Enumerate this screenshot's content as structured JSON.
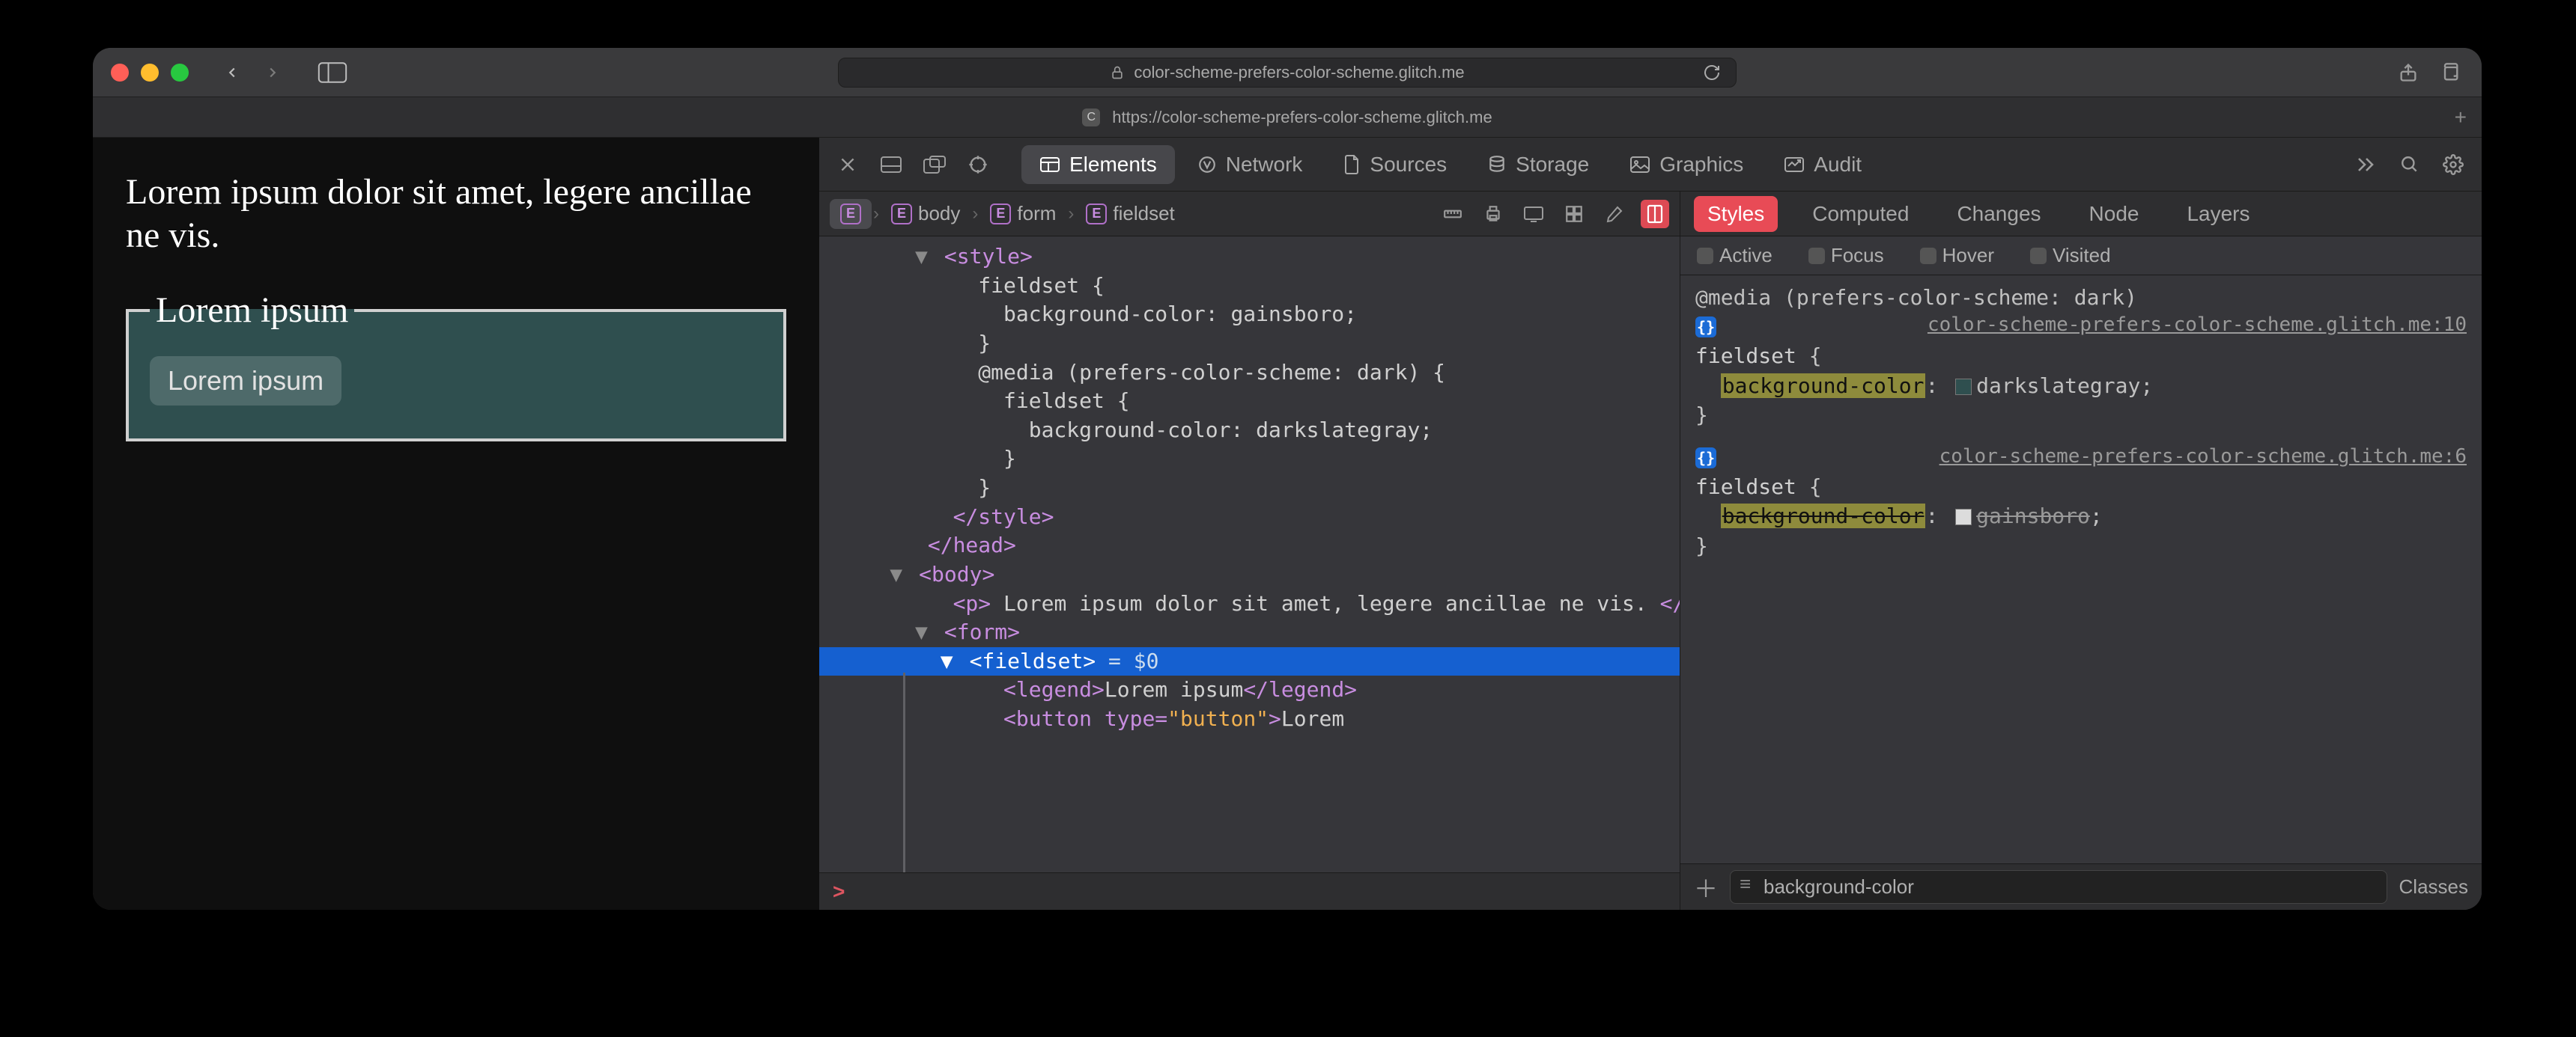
{
  "titlebar": {
    "url": "color-scheme-prefers-color-scheme.glitch.me"
  },
  "tab": {
    "favicon": "C",
    "title": "https://color-scheme-prefers-color-scheme.glitch.me"
  },
  "page": {
    "paragraph": "Lorem ipsum dolor sit amet, legere ancillae ne vis.",
    "legend": "Lorem ipsum",
    "button": "Lorem ipsum"
  },
  "devtools": {
    "tabs": {
      "elements": "Elements",
      "network": "Network",
      "sources": "Sources",
      "storage": "Storage",
      "graphics": "Graphics",
      "audit": "Audit"
    },
    "breadcrumb": {
      "root": "",
      "body": "body",
      "form": "form",
      "fieldset": "fieldset"
    },
    "dom": {
      "style_open": "<style>",
      "rule1_sel": "fieldset {",
      "rule1_decl": "background-color: gainsboro;",
      "rule1_close": "}",
      "media_open": "@media (prefers-color-scheme: dark) {",
      "rule2_sel": "fieldset {",
      "rule2_decl": "background-color: darkslategray;",
      "rule2_close": "}",
      "media_close": "}",
      "style_close": "</style>",
      "head_close": "</head>",
      "body_open": "<body>",
      "p_text": " Lorem ipsum dolor sit amet, legere ancillae ne vis. ",
      "form_open": "<form>",
      "fieldset_open": "<fieldset>",
      "dollar0": " = $0",
      "legend_open": "<legend>",
      "legend_text": "Lorem ipsum",
      "legend_close": "</legend>",
      "button_open": "<button type=",
      "button_type": "\"button\"",
      "button_open2": ">",
      "button_text": "Lorem"
    },
    "console_prompt": ">",
    "styles": {
      "tabs": {
        "styles": "Styles",
        "computed": "Computed",
        "changes": "Changes",
        "node": "Node",
        "layers": "Layers"
      },
      "pseudo": {
        "active": "Active",
        "focus": "Focus",
        "hover": "Hover",
        "visited": "Visited"
      },
      "rule1": {
        "media": "@media (prefers-color-scheme: dark)",
        "source": "color-scheme-prefers-color-scheme.glitch.me:10",
        "selector": "fieldset",
        "prop": "background-color",
        "value": "darkslategray",
        "swatch": "#2f4f4f"
      },
      "rule2": {
        "source": "color-scheme-prefers-color-scheme.glitch.me:6",
        "selector": "fieldset",
        "prop": "background-color",
        "value": "gainsboro",
        "swatch": "#dcdcdc"
      },
      "filter": "background-color",
      "classes": "Classes"
    }
  }
}
